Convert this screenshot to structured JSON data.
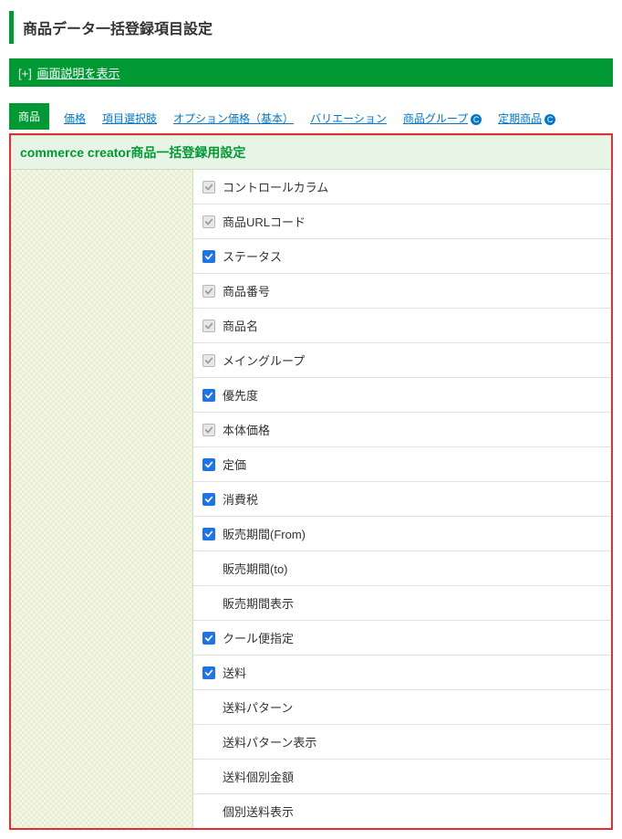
{
  "page_title": "商品データ一括登録項目設定",
  "expand": {
    "prefix": "[+]",
    "label": "画面説明を表示"
  },
  "tabs": [
    {
      "label": "商品",
      "active": true
    },
    {
      "label": "価格"
    },
    {
      "label": "項目選択肢"
    },
    {
      "label": "オプション価格（基本）"
    },
    {
      "label": "バリエーション"
    },
    {
      "label": "商品グループ",
      "icon": "C"
    },
    {
      "label": "定期商品",
      "icon": "C"
    }
  ],
  "panel": {
    "header": "commerce creator商品一括登録用設定",
    "rows": [
      {
        "label": "コントロールカラム",
        "checked": true,
        "disabled": true
      },
      {
        "label": "商品URLコード",
        "checked": true,
        "disabled": true
      },
      {
        "label": "ステータス",
        "checked": true,
        "disabled": false
      },
      {
        "label": "商品番号",
        "checked": true,
        "disabled": true
      },
      {
        "label": "商品名",
        "checked": true,
        "disabled": true
      },
      {
        "label": "メイングループ",
        "checked": true,
        "disabled": true
      },
      {
        "label": "優先度",
        "checked": true,
        "disabled": false
      },
      {
        "label": "本体価格",
        "checked": true,
        "disabled": true
      },
      {
        "label": "定価",
        "checked": true,
        "disabled": false
      },
      {
        "label": "消費税",
        "checked": true,
        "disabled": false
      },
      {
        "label": "販売期間(From)",
        "checked": true,
        "disabled": false
      },
      {
        "label": "販売期間(to)",
        "no_checkbox": true
      },
      {
        "label": "販売期間表示",
        "no_checkbox": true
      },
      {
        "label": "クール便指定",
        "checked": true,
        "disabled": false
      },
      {
        "label": "送料",
        "checked": true,
        "disabled": false
      },
      {
        "label": "送料パターン",
        "no_checkbox": true
      },
      {
        "label": "送料パターン表示",
        "no_checkbox": true
      },
      {
        "label": "送料個別金額",
        "no_checkbox": true
      },
      {
        "label": "個別送料表示",
        "no_checkbox": true
      }
    ]
  }
}
